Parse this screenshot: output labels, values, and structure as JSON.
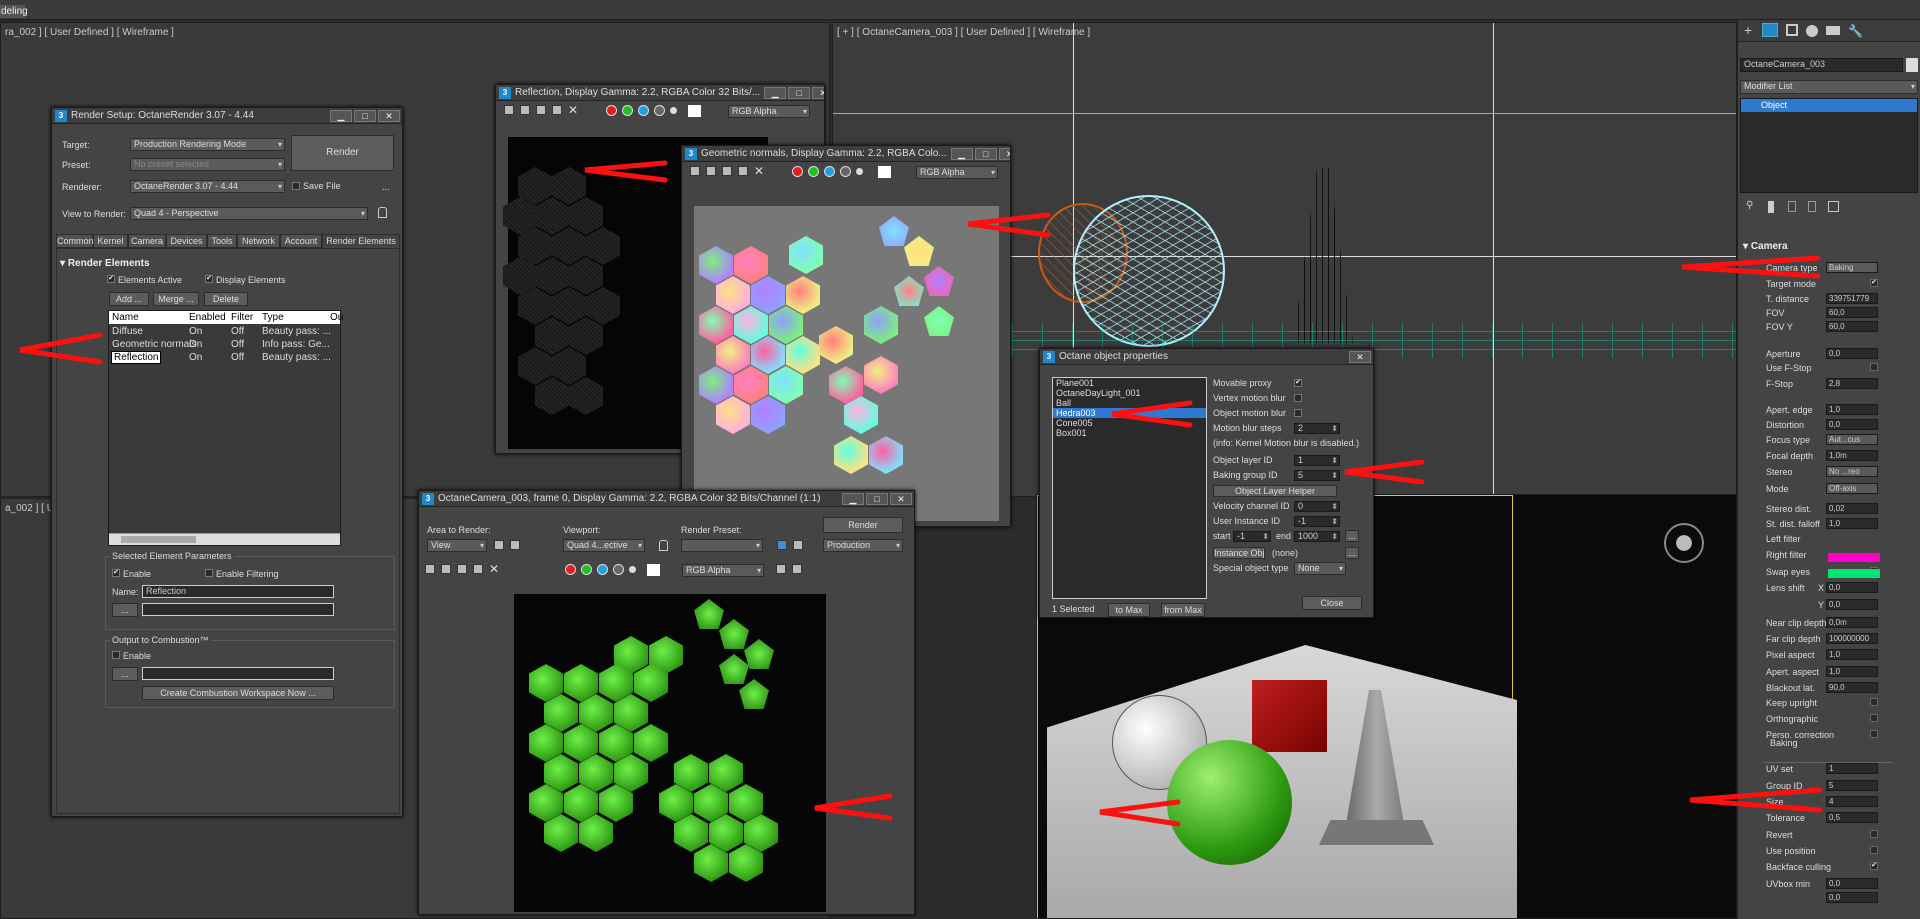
{
  "app": {
    "menu_item": "deling"
  },
  "viewports": {
    "top_left_label": "ra_002 ] [ User Defined ] [ Wireframe ]",
    "top_right_label": "[ + ] [ OctaneCamera_003 ] [ User Defined ] [ Wireframe ]",
    "bottom_left_label": "a_002 ] [ Ui"
  },
  "render_setup": {
    "title": "Render Setup: OctaneRender 3.07 - 4.44",
    "target_label": "Target:",
    "target_value": "Production Rendering Mode",
    "preset_label": "Preset:",
    "preset_value": "No preset selected",
    "renderer_label": "Renderer:",
    "renderer_value": "OctaneRender 3.07 - 4.44",
    "save_file": "Save File",
    "view_label": "View to Render:",
    "view_value": "Quad 4 - Perspective",
    "render_button": "Render",
    "ellipsis": "...",
    "tabs": [
      "Common",
      "Kernel",
      "Camera",
      "Devices",
      "Tools",
      "Network",
      "Account",
      "Render Elements"
    ],
    "rollout_title": "Render Elements",
    "elements_active": "Elements Active",
    "display_elements": "Display Elements",
    "add_button": "Add ...",
    "merge_button": "Merge ...",
    "delete_button": "Delete",
    "columns": [
      "Name",
      "Enabled",
      "Filter",
      "Type",
      "Ou"
    ],
    "rows": [
      {
        "name": "Diffuse",
        "enabled": "On",
        "filter": "Off",
        "type": "Beauty pass: ..."
      },
      {
        "name": "Geometric normals",
        "enabled": "On",
        "filter": "Off",
        "type": "Info pass: Ge..."
      },
      {
        "name": "Reflection",
        "enabled": "On",
        "filter": "Off",
        "type": "Beauty pass: ..."
      }
    ],
    "selected_params_title": "Selected Element Parameters",
    "enable": "Enable",
    "enable_filtering": "Enable Filtering",
    "name_label": "Name:",
    "name_value": "Reflection",
    "output_combustion": "Output to Combustion™",
    "enable2": "Enable",
    "create_combustion": "Create Combustion Workspace Now ..."
  },
  "reflection_window": {
    "title": "Reflection, Display Gamma: 2.2, RGBA Color 32 Bits/...",
    "channel": "RGB Alpha"
  },
  "normals_window": {
    "title": "Geometric normals, Display Gamma: 2.2, RGBA Colo...",
    "channel": "RGB Alpha"
  },
  "camera_window": {
    "title": "OctaneCamera_003, frame 0, Display Gamma: 2.2, RGBA Color 32 Bits/Channel (1:1)",
    "area_label": "Area to Render:",
    "area_value": "View",
    "viewport_label": "Viewport:",
    "viewport_value": "Quad 4...ective",
    "preset_label": "Render Preset:",
    "preset_value": "",
    "render_button": "Render",
    "production_value": "Production",
    "channel": "RGB Alpha"
  },
  "octane_props": {
    "title": "Octane object properties",
    "objects": [
      "Plane001",
      "OctaneDayLight_001",
      "Ball",
      "Hedra003",
      "Cone005",
      "Box001"
    ],
    "selected_index": 3,
    "movable_proxy": "Movable proxy",
    "vertex_motion_blur": "Vertex motion blur",
    "object_motion_blur": "Object motion blur",
    "motion_blur_steps": "Motion blur steps",
    "motion_blur_steps_value": "2",
    "info_text": "(info: Kernel Motion blur is disabled.)",
    "object_layer_id": "Object layer ID",
    "object_layer_id_value": "1",
    "baking_group_id": "Baking group ID",
    "baking_group_id_value": "5",
    "object_layer_helper": "Object Layer Helper",
    "velocity_channel_id": "Velocity channel ID",
    "velocity_channel_id_value": "0",
    "user_instance_id": "User Instance ID",
    "user_instance_id_value": "-1",
    "start_label": "start",
    "start_value": "-1",
    "end_label": "end",
    "end_value": "1000",
    "instance_obj": "Instance Obj:",
    "instance_none": "(none)",
    "special_object_type": "Special object type",
    "special_value": "None",
    "selected_count": "1 Selected",
    "to_max": "to Max",
    "from_max": "from Max",
    "close": "Close",
    "ellipsis": "..."
  },
  "right_panel": {
    "object_name": "OctaneCamera_003",
    "modifier_list": "Modifier List",
    "stack_item": "Object",
    "camera_title": "Camera",
    "camera_type": "Camera type",
    "camera_type_value": "Baking",
    "target_mode": "Target mode",
    "t_distance": "T. distance",
    "t_distance_value": "339751779",
    "fov": "FOV",
    "fov_value": "60,0",
    "fov_y": "FOV Y",
    "fov_y_value": "60,0",
    "aperture": "Aperture",
    "aperture_value": "0,0",
    "use_fstop": "Use F-Stop",
    "fstop": "F-Stop",
    "fstop_value": "2,8",
    "apert_edge": "Apert. edge",
    "apert_edge_value": "1,0",
    "distortion": "Distortion",
    "distortion_value": "0,0",
    "focus_type": "Focus type",
    "focus_type_value": "Aut...cus",
    "focal_depth": "Focal depth",
    "focal_depth_value": "1,0m",
    "stereo": "Stereo",
    "stereo_value": "No ...reo",
    "mode": "Mode",
    "mode_value": "Off-axis",
    "stereo_dist": "Stereo dist.",
    "stereo_dist_value": "0,02",
    "st_dist_falloff": "St. dist. falloff",
    "st_dist_falloff_value": "1,0",
    "left_filter": "Left filter",
    "left_filter_color": "#ff00cc",
    "right_filter": "Right filter",
    "right_filter_color": "#00e676",
    "swap_eyes": "Swap eyes",
    "lens_shift": "Lens shift",
    "x_label": "X",
    "x_value": "0,0",
    "y_label": "Y",
    "y_value": "0,0",
    "near_clip": "Near clip depth",
    "near_clip_value": "0,0m",
    "far_clip": "Far clip depth",
    "far_clip_value": "100000000",
    "pixel_aspect": "Pixel aspect",
    "pixel_aspect_value": "1,0",
    "apert_aspect": "Apert. aspect",
    "apert_aspect_value": "1,0",
    "blackout_lat": "Blackout lat.",
    "blackout_lat_value": "90,0",
    "keep_upright": "Keep upright",
    "orthographic": "Orthographic",
    "persp_correction": "Persp. correction",
    "baking_title": "Baking",
    "uv_set": "UV set",
    "uv_set_value": "1",
    "group_id": "Group ID",
    "group_id_value": "5",
    "size": "Size",
    "size_value": "4",
    "tolerance": "Tolerance",
    "tolerance_value": "0,5",
    "revert": "Revert",
    "use_position": "Use position",
    "backface_culling": "Backface culling",
    "uvbox_min": "UVbox min",
    "uvbox_min_value": "0,0",
    "uvbox_min2_value": "0,0"
  },
  "colors": {
    "accent": "#1e88c8",
    "arrow": "#ff1010",
    "green": "#3ec020"
  }
}
